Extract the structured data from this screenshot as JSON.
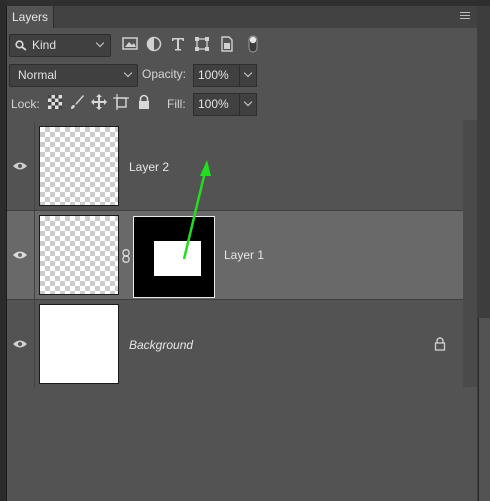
{
  "panel": {
    "tab_label": "Layers"
  },
  "filter": {
    "kind_label": "Kind",
    "icons": [
      "search-icon",
      "image-filter-icon",
      "adjustment-filter-icon",
      "type-filter-icon",
      "shape-filter-icon",
      "smart-object-filter-icon",
      "filter-toggle-icon"
    ]
  },
  "blend": {
    "mode": "Normal",
    "opacity_label": "Opacity:",
    "opacity_value": "100%"
  },
  "lock": {
    "label": "Lock:",
    "icons": [
      "lock-transparent-pixels-icon",
      "lock-image-pixels-icon",
      "lock-position-icon",
      "lock-artboard-icon",
      "lock-all-icon"
    ],
    "fill_label": "Fill:",
    "fill_value": "100%"
  },
  "layers": [
    {
      "name": "Layer 2",
      "visible": true,
      "selected": false,
      "has_mask": false
    },
    {
      "name": "Layer 1",
      "visible": true,
      "selected": true,
      "has_mask": true
    },
    {
      "name": "Background",
      "visible": true,
      "selected": false,
      "locked": true,
      "italic": true
    }
  ],
  "colors": {
    "panel_bg": "#535353",
    "selected_row": "#696969",
    "annotation_arrow": "#22dd22"
  }
}
